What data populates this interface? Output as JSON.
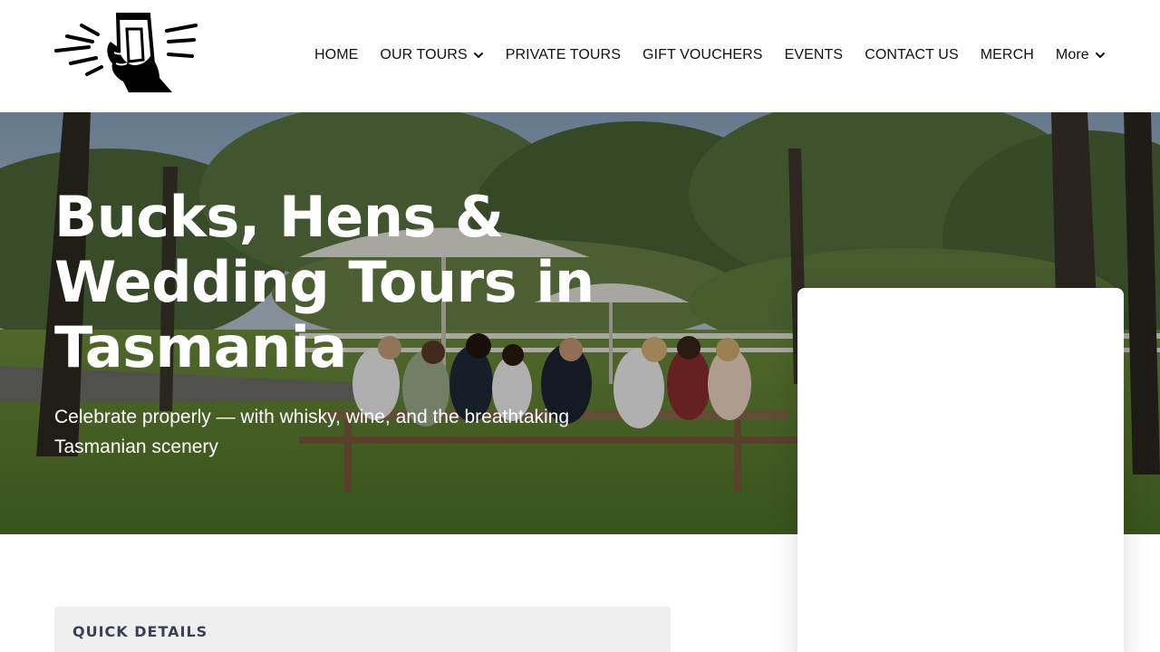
{
  "header": {
    "logo_icon": "hand-holding-glass-logo",
    "nav": [
      {
        "label": "HOME",
        "has_dropdown": false
      },
      {
        "label": "OUR TOURS",
        "has_dropdown": true
      },
      {
        "label": "PRIVATE TOURS",
        "has_dropdown": false
      },
      {
        "label": "GIFT VOUCHERS",
        "has_dropdown": false
      },
      {
        "label": "EVENTS",
        "has_dropdown": false
      },
      {
        "label": "CONTACT US",
        "has_dropdown": false
      },
      {
        "label": "MERCH",
        "has_dropdown": false
      },
      {
        "label": "More",
        "has_dropdown": true
      }
    ]
  },
  "hero": {
    "title": "Bucks, Hens & Wedding Tours in Tasmania",
    "subtitle": "Celebrate properly — with whisky, wine, and the breathtaking Tasmanian scenery"
  },
  "quick_details": {
    "title": "QUICK DETAILS"
  },
  "colors": {
    "nav_text": "#111111",
    "hero_text": "#ffffff",
    "quick_bg": "#efefef",
    "quick_title": "#3a4250"
  }
}
